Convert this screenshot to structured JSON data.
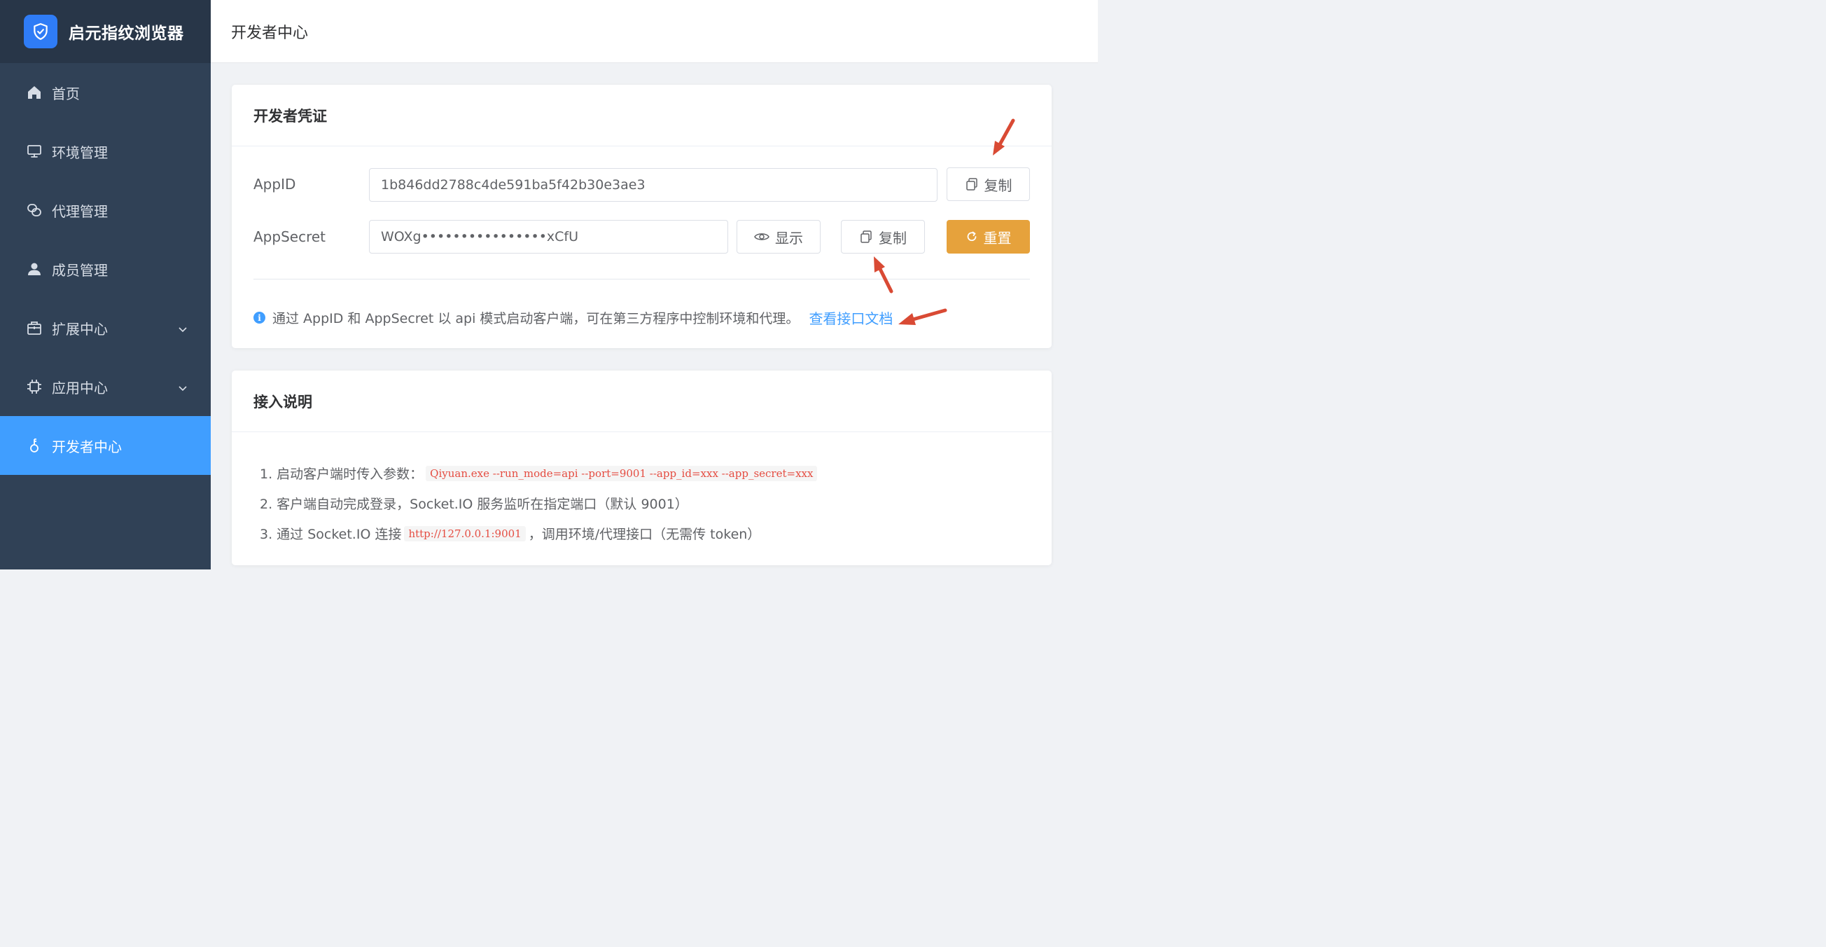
{
  "app": {
    "name": "启元指纹浏览器",
    "logo_icon": "shield-check-icon"
  },
  "sidebar": {
    "items": [
      {
        "label": "首页",
        "icon": "home-icon"
      },
      {
        "label": "环境管理",
        "icon": "monitor-icon"
      },
      {
        "label": "代理管理",
        "icon": "link-icon"
      },
      {
        "label": "成员管理",
        "icon": "user-icon"
      },
      {
        "label": "扩展中心",
        "icon": "package-icon",
        "expandable": true
      },
      {
        "label": "应用中心",
        "icon": "chip-icon",
        "expandable": true
      },
      {
        "label": "开发者中心",
        "icon": "key-icon",
        "active": true
      }
    ]
  },
  "header": {
    "title": "开发者中心"
  },
  "credentials": {
    "title": "开发者凭证",
    "appid_label": "AppID",
    "appid_value": "1b846dd2788c4de591ba5f42b30e3ae3",
    "appsecret_label": "AppSecret",
    "appsecret_value": "WOXg••••••••••••••••xCfU",
    "copy_label": "复制",
    "show_label": "显示",
    "reset_label": "重置",
    "tip_text": "通过 AppID 和 AppSecret 以 api 模式启动客户端，可在第三方程序中控制环境和代理。",
    "doc_link": "查看接口文档"
  },
  "integration": {
    "title": "接入说明",
    "step1_text": "1. 启动客户端时传入参数：",
    "step1_code": "Qiyuan.exe --run_mode=api --port=9001 --app_id=xxx --app_secret=xxx",
    "step2_text": "2. 客户端自动完成登录，Socket.IO 服务监听在指定端口（默认 9001）",
    "step3_prefix": "3. 通过 Socket.IO 连接",
    "step3_code": "http://127.0.0.1:9001",
    "step3_suffix": "，调用环境/代理接口（无需传 token）"
  },
  "colors": {
    "sidebar_bg": "#304156",
    "active": "#409eff",
    "warning": "#e6a23c",
    "annotation_arrow": "#d94a34"
  }
}
